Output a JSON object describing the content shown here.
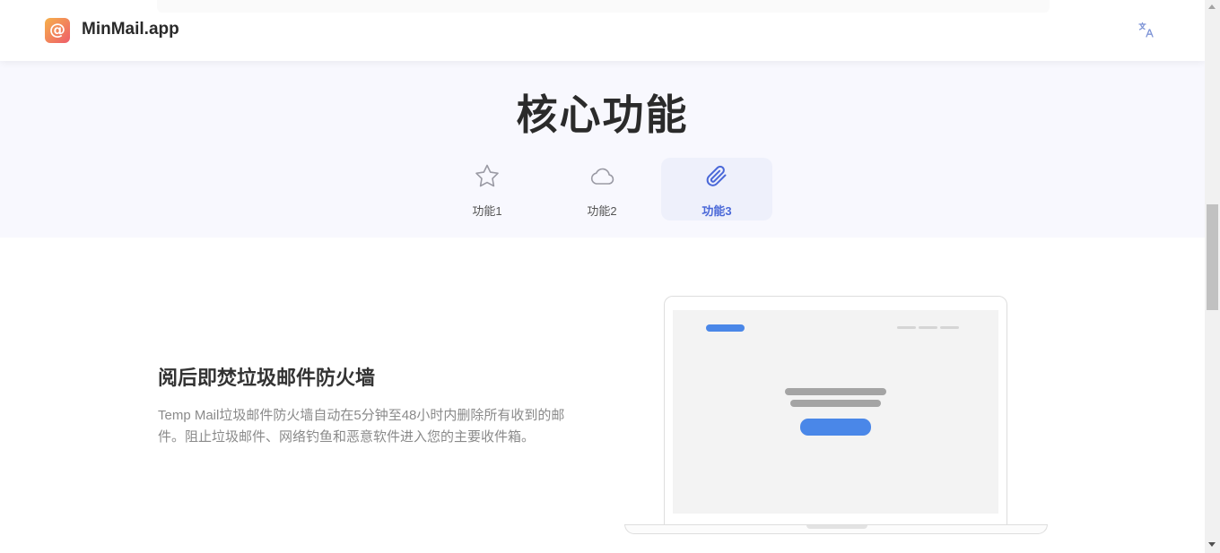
{
  "header": {
    "logo_icon": "at-sign-icon",
    "logo_glyph": "@",
    "brand": "MinMail.app",
    "language_icon": "translate-icon"
  },
  "features": {
    "title": "核心功能",
    "tabs": [
      {
        "label": "功能1",
        "icon": "star-icon",
        "active": false
      },
      {
        "label": "功能2",
        "icon": "cloud-icon",
        "active": false
      },
      {
        "label": "功能3",
        "icon": "paperclip-icon",
        "active": true
      }
    ]
  },
  "content": {
    "heading": "阅后即焚垃圾邮件防火墙",
    "description": "Temp Mail垃圾邮件防火墙自动在5分钟至48小时内删除所有收到的邮件。阻止垃圾邮件、网络钓鱼和恶意软件进入您的主要收件箱。"
  },
  "colors": {
    "accent": "#4a68d8",
    "band_background": "#f8f8fe",
    "illustration_blue": "#4a87e8"
  }
}
